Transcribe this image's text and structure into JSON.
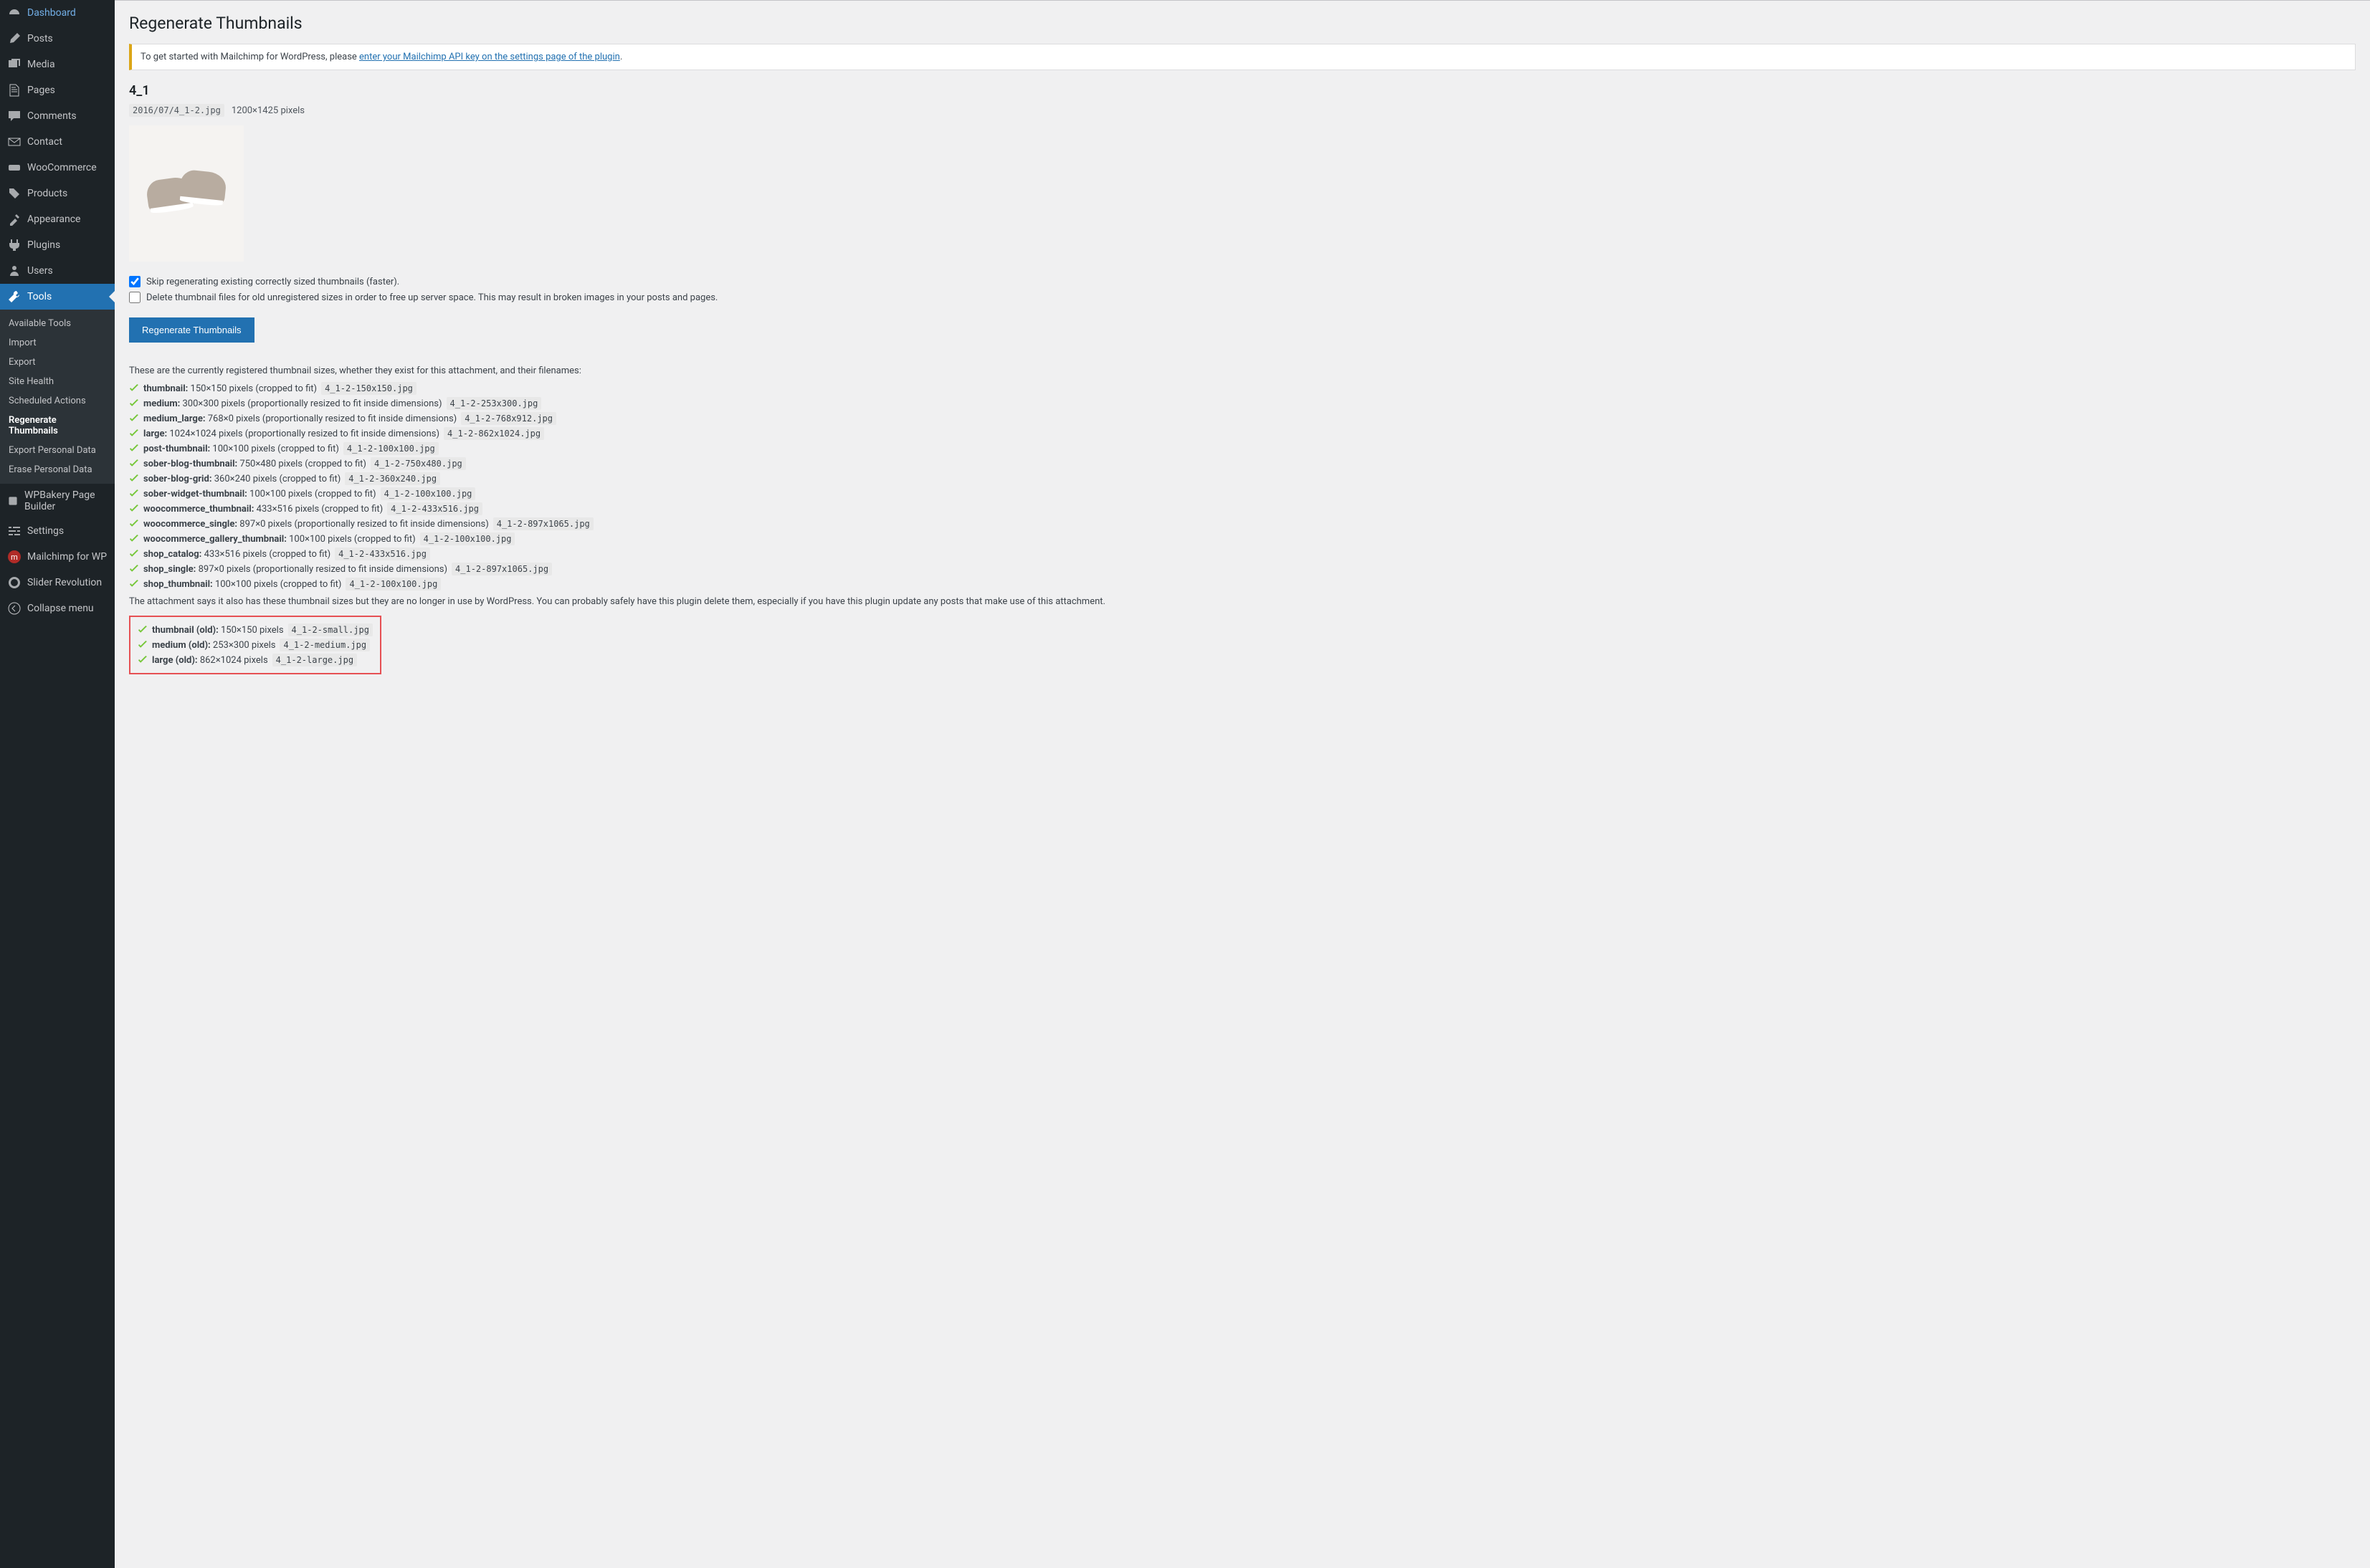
{
  "sidebar": {
    "items": [
      {
        "icon": "dashboard",
        "label": "Dashboard"
      },
      {
        "icon": "posts",
        "label": "Posts"
      },
      {
        "icon": "media",
        "label": "Media"
      },
      {
        "icon": "pages",
        "label": "Pages"
      },
      {
        "icon": "comments",
        "label": "Comments"
      },
      {
        "icon": "contact",
        "label": "Contact"
      },
      {
        "icon": "woo",
        "label": "WooCommerce"
      },
      {
        "icon": "products",
        "label": "Products"
      },
      {
        "icon": "appearance",
        "label": "Appearance"
      },
      {
        "icon": "plugins",
        "label": "Plugins"
      },
      {
        "icon": "users",
        "label": "Users"
      },
      {
        "icon": "tools",
        "label": "Tools",
        "active": true
      },
      {
        "icon": "wpbakery",
        "label": "WPBakery Page Builder"
      },
      {
        "icon": "settings",
        "label": "Settings"
      },
      {
        "icon": "mailchimp",
        "label": "Mailchimp for WP"
      },
      {
        "icon": "slider",
        "label": "Slider Revolution"
      },
      {
        "icon": "collapse",
        "label": "Collapse menu"
      }
    ],
    "submenu": [
      "Available Tools",
      "Import",
      "Export",
      "Site Health",
      "Scheduled Actions",
      "Regenerate Thumbnails",
      "Export Personal Data",
      "Erase Personal Data"
    ]
  },
  "page": {
    "title": "Regenerate Thumbnails",
    "notice_prefix": "To get started with Mailchimp for WordPress, please ",
    "notice_link": "enter your Mailchimp API key on the settings page of the plugin",
    "notice_suffix": ".",
    "attachment_title": "4_1",
    "attachment_path": "2016/07/4_1-2.jpg",
    "attachment_dims": "1200×1425 pixels",
    "checkbox_skip": "Skip regenerating existing correctly sized thumbnails (faster).",
    "checkbox_delete": "Delete thumbnail files for old unregistered sizes in order to free up server space. This may result in broken images in your posts and pages.",
    "button": "Regenerate Thumbnails",
    "registered_intro": "These are the currently registered thumbnail sizes, whether they exist for this attachment, and their filenames:",
    "unused_intro": "The attachment says it also has these thumbnail sizes but they are no longer in use by WordPress. You can probably safely have this plugin delete them, especially if you have this plugin update any posts that make use of this attachment.",
    "sizes": [
      {
        "name": "thumbnail",
        "desc": "150×150 pixels (cropped to fit)",
        "file": "4_1-2-150x150.jpg"
      },
      {
        "name": "medium",
        "desc": "300×300 pixels (proportionally resized to fit inside dimensions)",
        "file": "4_1-2-253x300.jpg"
      },
      {
        "name": "medium_large",
        "desc": "768×0 pixels (proportionally resized to fit inside dimensions)",
        "file": "4_1-2-768x912.jpg"
      },
      {
        "name": "large",
        "desc": "1024×1024 pixels (proportionally resized to fit inside dimensions)",
        "file": "4_1-2-862x1024.jpg"
      },
      {
        "name": "post-thumbnail",
        "desc": "100×100 pixels (cropped to fit)",
        "file": "4_1-2-100x100.jpg"
      },
      {
        "name": "sober-blog-thumbnail",
        "desc": "750×480 pixels (cropped to fit)",
        "file": "4_1-2-750x480.jpg"
      },
      {
        "name": "sober-blog-grid",
        "desc": "360×240 pixels (cropped to fit)",
        "file": "4_1-2-360x240.jpg"
      },
      {
        "name": "sober-widget-thumbnail",
        "desc": "100×100 pixels (cropped to fit)",
        "file": "4_1-2-100x100.jpg"
      },
      {
        "name": "woocommerce_thumbnail",
        "desc": "433×516 pixels (cropped to fit)",
        "file": "4_1-2-433x516.jpg"
      },
      {
        "name": "woocommerce_single",
        "desc": "897×0 pixels (proportionally resized to fit inside dimensions)",
        "file": "4_1-2-897x1065.jpg"
      },
      {
        "name": "woocommerce_gallery_thumbnail",
        "desc": "100×100 pixels (cropped to fit)",
        "file": "4_1-2-100x100.jpg"
      },
      {
        "name": "shop_catalog",
        "desc": "433×516 pixels (cropped to fit)",
        "file": "4_1-2-433x516.jpg"
      },
      {
        "name": "shop_single",
        "desc": "897×0 pixels (proportionally resized to fit inside dimensions)",
        "file": "4_1-2-897x1065.jpg"
      },
      {
        "name": "shop_thumbnail",
        "desc": "100×100 pixels (cropped to fit)",
        "file": "4_1-2-100x100.jpg"
      }
    ],
    "unused_sizes": [
      {
        "name": "thumbnail (old)",
        "desc": "150×150 pixels",
        "file": "4_1-2-small.jpg"
      },
      {
        "name": "medium (old)",
        "desc": "253×300 pixels",
        "file": "4_1-2-medium.jpg"
      },
      {
        "name": "large (old)",
        "desc": "862×1024 pixels",
        "file": "4_1-2-large.jpg"
      }
    ]
  }
}
